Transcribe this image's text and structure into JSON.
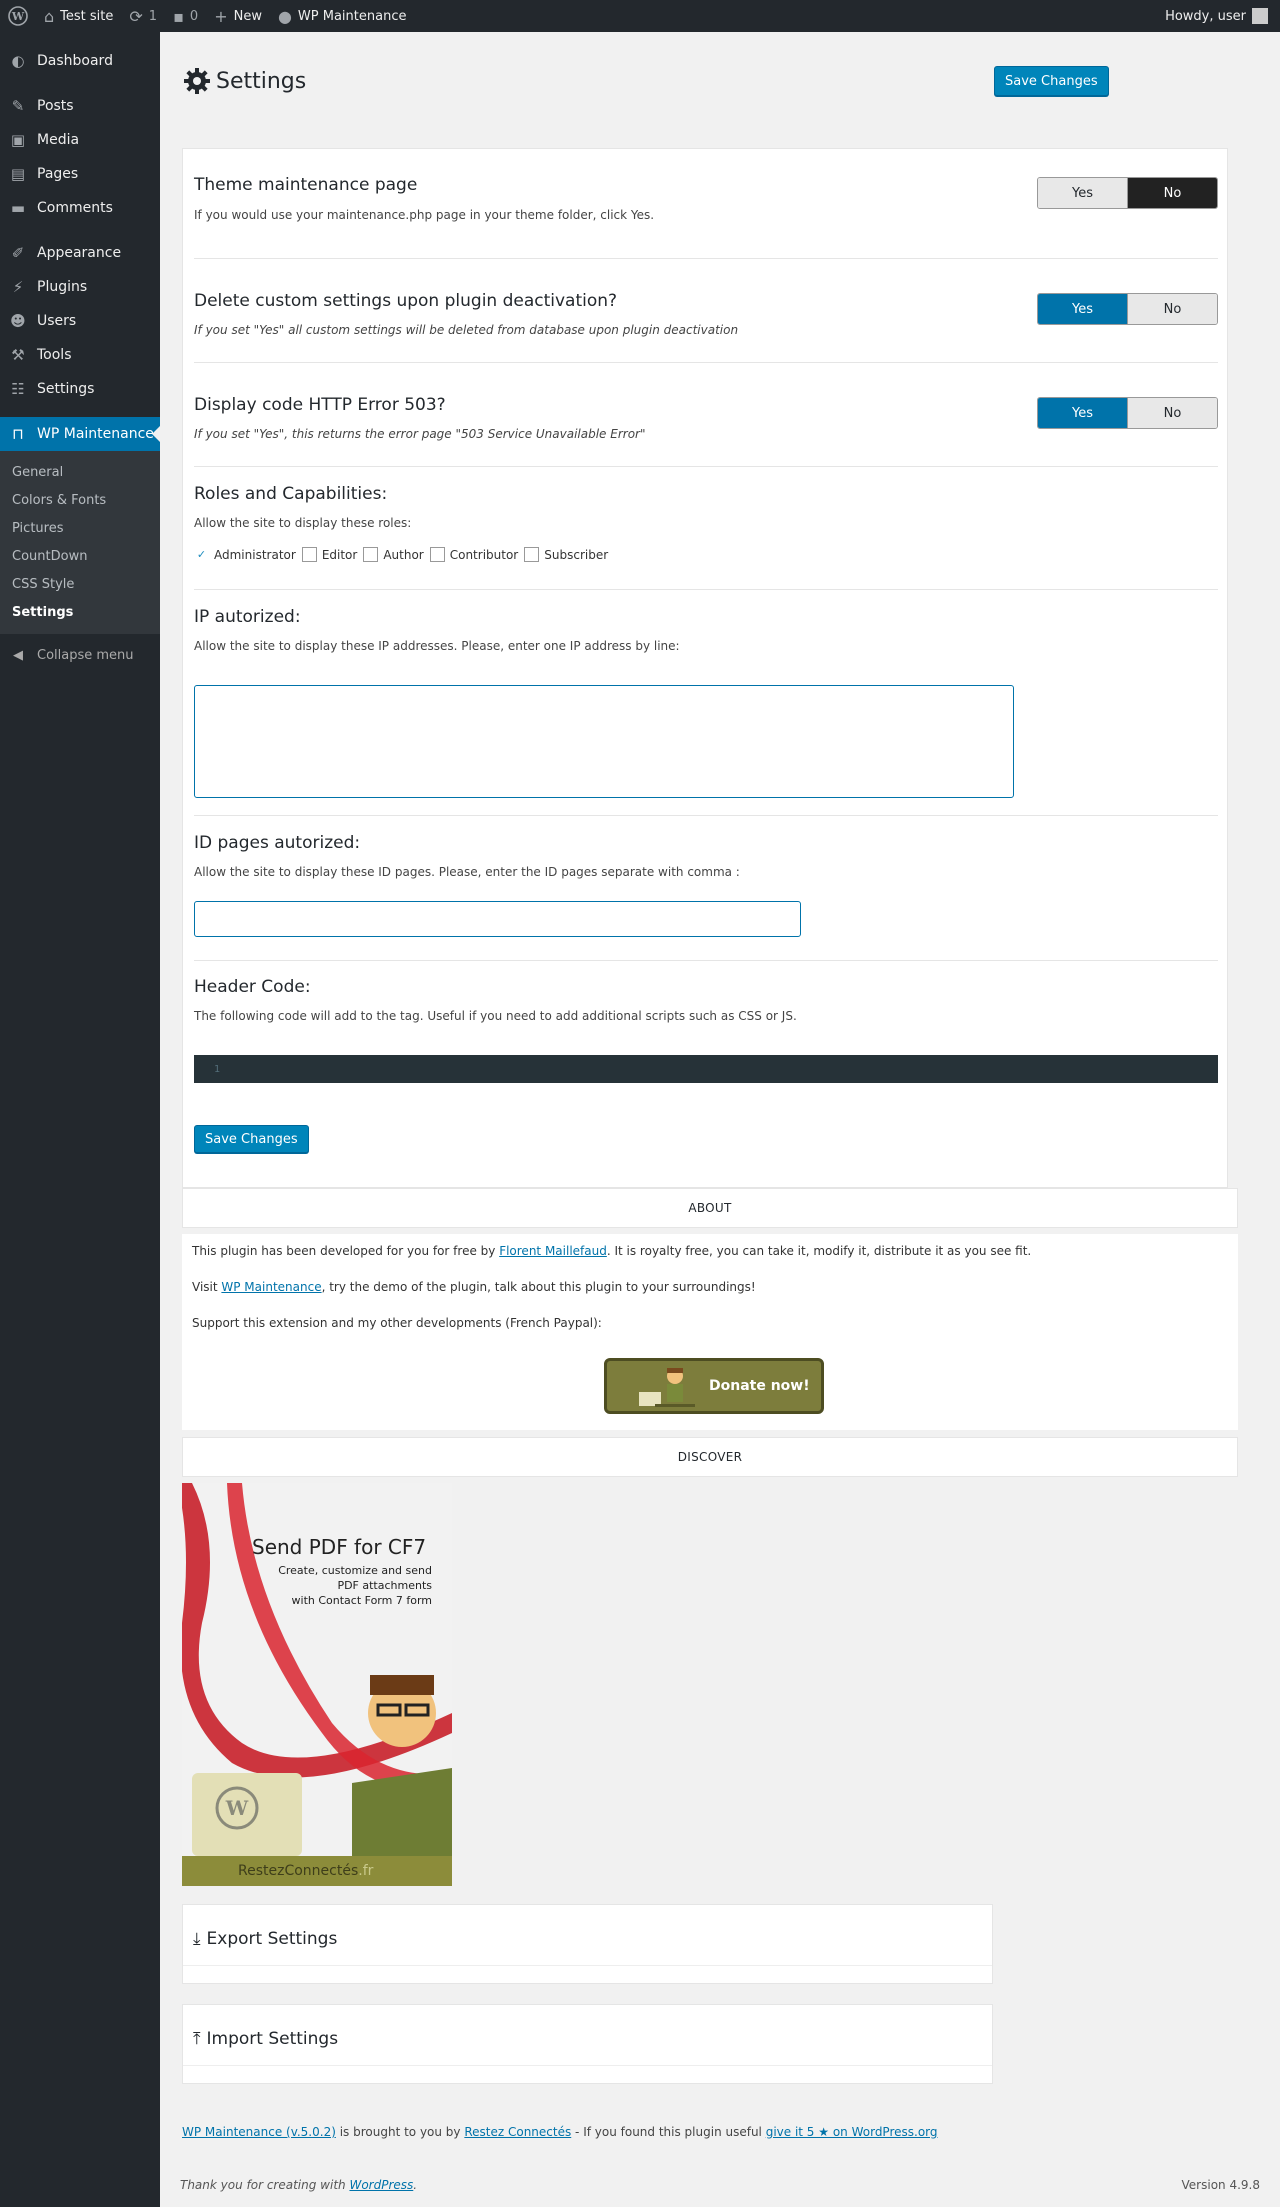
{
  "adminbar": {
    "site_name": "Test site",
    "updates_count": "1",
    "comments_count": "0",
    "new_label": "New",
    "plugin_label": "WP Maintenance",
    "howdy": "Howdy, user"
  },
  "sidebar": {
    "items": [
      {
        "label": "Dashboard",
        "icon": "dashboard-icon"
      },
      {
        "label": "Posts",
        "icon": "pin-icon"
      },
      {
        "label": "Media",
        "icon": "media-icon"
      },
      {
        "label": "Pages",
        "icon": "page-icon"
      },
      {
        "label": "Comments",
        "icon": "comment-icon"
      },
      {
        "label": "Appearance",
        "icon": "brush-icon"
      },
      {
        "label": "Plugins",
        "icon": "plug-icon"
      },
      {
        "label": "Users",
        "icon": "user-icon"
      },
      {
        "label": "Tools",
        "icon": "wrench-icon"
      },
      {
        "label": "Settings",
        "icon": "sliders-icon"
      },
      {
        "label": "WP Maintenance",
        "icon": "maintenance-icon"
      }
    ],
    "submenu": [
      "General",
      "Colors & Fonts",
      "Pictures",
      "CountDown",
      "CSS Style",
      "Settings"
    ],
    "collapse_label": "Collapse menu"
  },
  "page": {
    "title": "Settings",
    "save_label": "Save Changes"
  },
  "sections": {
    "theme": {
      "title": "Theme maintenance page",
      "desc": "If you would use your maintenance.php page in your theme folder, click Yes.",
      "yes": "Yes",
      "no": "No",
      "selected": "No"
    },
    "delete": {
      "title": "Delete custom settings upon plugin deactivation?",
      "desc": "If you set \"Yes\" all custom settings will be deleted from database upon plugin deactivation",
      "yes": "Yes",
      "no": "No",
      "selected": "Yes"
    },
    "error503": {
      "title": "Display code HTTP Error 503?",
      "desc": "If you set \"Yes\", this returns the error page \"503 Service Unavailable Error\"",
      "yes": "Yes",
      "no": "No",
      "selected": "Yes"
    },
    "roles": {
      "title": "Roles and Capabilities:",
      "desc": "Allow the site to display these roles:",
      "items": [
        {
          "label": "Administrator",
          "checked": true
        },
        {
          "label": "Editor",
          "checked": false
        },
        {
          "label": "Author",
          "checked": false
        },
        {
          "label": "Contributor",
          "checked": false
        },
        {
          "label": "Subscriber",
          "checked": false
        }
      ]
    },
    "ip": {
      "title": "IP autorized:",
      "desc": "Allow the site to display these IP addresses. Please, enter one IP address by line:",
      "value": ""
    },
    "idpages": {
      "title": "ID pages autorized:",
      "desc": "Allow the site to display these ID pages. Please, enter the ID pages separate with comma :",
      "value": ""
    },
    "header_code": {
      "title": "Header Code:",
      "desc": "The following code will add to the tag. Useful if you need to add additional scripts such as CSS or JS.",
      "line_number": "1"
    }
  },
  "about": {
    "header": "ABOUT",
    "p1_before": "This plugin has been developed for you for free by ",
    "p1_link": "Florent Maillefaud",
    "p1_after": ". It is royalty free, you can take it, modify it, distribute it as you see fit.",
    "p2_before": "Visit ",
    "p2_link": "WP Maintenance",
    "p2_after": ", try the demo of the plugin, talk about this plugin to your surroundings!",
    "p3": "Support this extension and my other developments (French Paypal):",
    "donate_label": "Donate now!"
  },
  "discover": {
    "header": "DISCOVER",
    "banner_title": "Send PDF for CF7",
    "banner_sub1": "Create, customize and send",
    "banner_sub2": "PDF attachments",
    "banner_sub3": "with Contact Form 7 form",
    "banner_footer": "RestezConnectés",
    "banner_footer_tld": ".fr"
  },
  "export": {
    "title": "Export Settings"
  },
  "import": {
    "title": "Import Settings"
  },
  "footer": {
    "plugin_link": "WP Maintenance (v.5.0.2)",
    "brought": " is brought to you by ",
    "author_link": "Restez Connectés",
    "middle": " - If you found this plugin useful ",
    "rate_link": "give it 5 ★ on WordPress.org",
    "thanks_before": "Thank you for creating with ",
    "thanks_link": "WordPress",
    "thanks_after": ".",
    "version": "Version 4.9.8"
  },
  "colors": {
    "accent": "#0073aa",
    "adminbar": "#23282d",
    "toggle_dark": "#222222",
    "donate": "#7d7d3c"
  }
}
